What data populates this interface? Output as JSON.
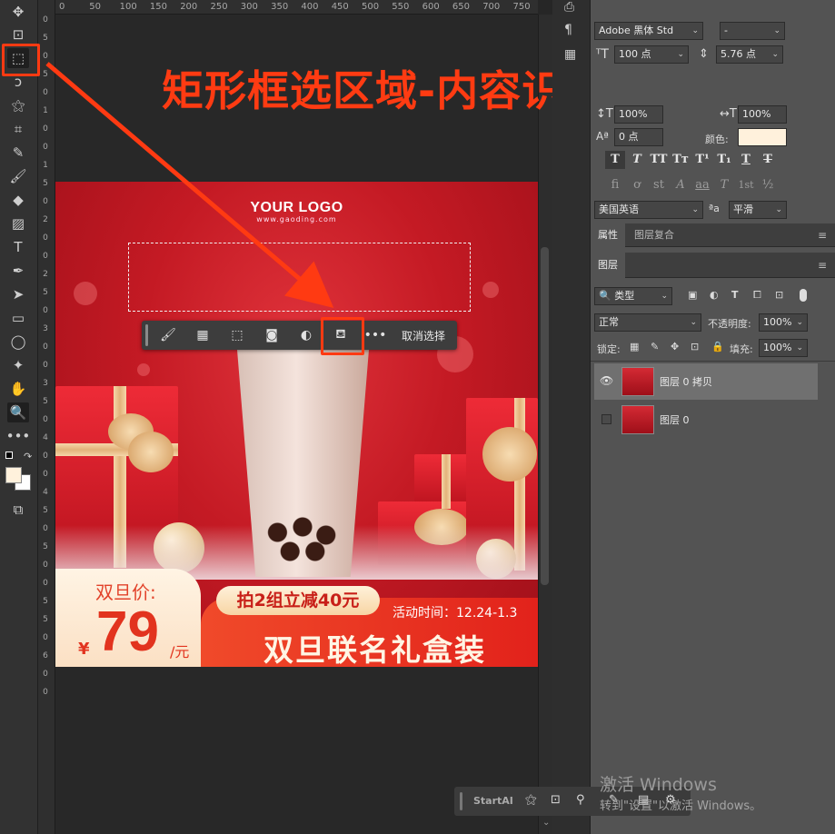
{
  "rulers": {
    "horizontal_ticks": [
      "0",
      "50",
      "100",
      "150",
      "200",
      "250",
      "300",
      "350",
      "400",
      "450",
      "500",
      "550",
      "600",
      "650",
      "700",
      "750"
    ],
    "vertical_ticks": [
      "0",
      "5",
      "0",
      "5",
      "0",
      "1",
      "0",
      "0",
      "1",
      "5",
      "0",
      "2",
      "0",
      "0",
      "2",
      "5",
      "0",
      "3",
      "0",
      "0",
      "3",
      "5",
      "0",
      "4",
      "0",
      "0",
      "4",
      "5",
      "0",
      "5",
      "0",
      "0",
      "5",
      "5",
      "0",
      "6",
      "0",
      "0"
    ]
  },
  "annotation": {
    "headline": "矩形框选区域-内容识别填充",
    "accent_color": "#ff3a12"
  },
  "artwork": {
    "logo": "YOUR LOGO",
    "logo_url": "www.gaoding.com",
    "price_label": "双旦价:",
    "currency": "¥",
    "price": "79",
    "unit": "/元",
    "promo_pill": "拍2组立减40元",
    "promo_time": "活动时间：12.24-1.3",
    "promo_title": "双旦联名礼盒装"
  },
  "context_bar": {
    "items": [
      "brush-icon",
      "mask-icon",
      "transform-icon",
      "layer-mask-icon",
      "adjustment-icon",
      "content-aware-fill-icon",
      "more-icon"
    ],
    "deselect_label": "取消选择"
  },
  "character_panel": {
    "font_family": "Adobe 黑体 Std",
    "font_style": "-",
    "font_size": "100 点",
    "leading": "5.76 点",
    "vertical_scale": "100%",
    "horizontal_scale": "100%",
    "baseline_shift": "0 点",
    "color_label": "颜色:",
    "text_color": "#fff1dc",
    "language": "美国英语",
    "aa_label": "ªa",
    "antialias": "平滑",
    "style_buttons": [
      "T",
      "T",
      "TT",
      "Tт",
      "T¹",
      "T₁",
      "T",
      "T"
    ],
    "opentype_buttons": [
      "fi",
      "ơ",
      "st",
      "A",
      "aa",
      "T",
      "1st",
      "½"
    ]
  },
  "properties_tabs": [
    "属性",
    "图层复合"
  ],
  "layers_panel": {
    "tab": "图层",
    "filter_label": "类型",
    "blend_mode": "正常",
    "opacity_label": "不透明度:",
    "opacity": "100%",
    "lock_label": "锁定:",
    "fill_label": "填充:",
    "fill": "100%",
    "layers": [
      {
        "name": "图层 0 拷贝",
        "visible": true,
        "selected": true
      },
      {
        "name": "图层 0",
        "visible": false,
        "selected": false
      }
    ]
  },
  "startai": {
    "label": "StartAI"
  },
  "watermark": {
    "line1": "激活 Windows",
    "line2": "转到\"设置\"以激活 Windows。"
  }
}
